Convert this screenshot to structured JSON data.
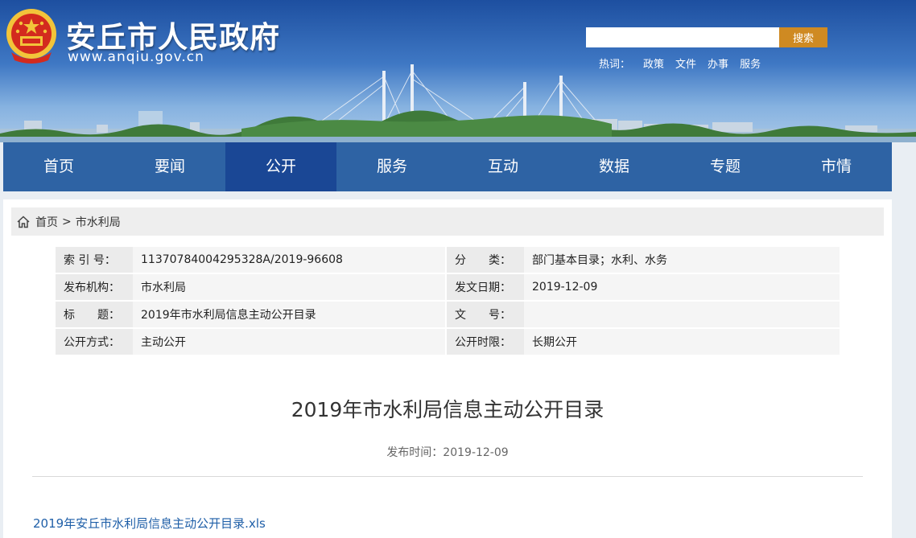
{
  "header": {
    "title": "安丘市人民政府",
    "domain": "www.anqiu.gov.cn",
    "search_placeholder": "",
    "search_button": "搜索",
    "hot_label": "热词：",
    "hot_words": [
      "政策",
      "文件",
      "办事",
      "服务"
    ]
  },
  "nav": {
    "items": [
      "首页",
      "要闻",
      "公开",
      "服务",
      "互动",
      "数据",
      "专题",
      "市情"
    ],
    "active": "公开"
  },
  "breadcrumb": {
    "home": "首页",
    "separator": ">",
    "current": "市水利局"
  },
  "meta": {
    "index_label": "索 引 号：",
    "index_value": "11370784004295328A/2019-96608",
    "category_label": "分　　类：",
    "category_value": "部门基本目录；水利、水务",
    "publisher_label": "发布机构：",
    "publisher_value": "市水利局",
    "date_label": "发文日期：",
    "date_value": "2019-12-09",
    "title_label": "标　　题：",
    "title_value": "2019年市水利局信息主动公开目录",
    "docno_label": "文　　号：",
    "docno_value": "",
    "mode_label": "公开方式：",
    "mode_value": "主动公开",
    "limit_label": "公开时限：",
    "limit_value": "长期公开"
  },
  "article": {
    "title": "2019年市水利局信息主动公开目录",
    "publish_time": "发布时间：2019-12-09",
    "attachment": "2019年安丘市水利局信息主动公开目录.xls"
  },
  "colors": {
    "nav_bg": "#2e63a4",
    "nav_active": "#1a4795",
    "search_button": "#cf8a22",
    "link": "#1f5fa8"
  }
}
